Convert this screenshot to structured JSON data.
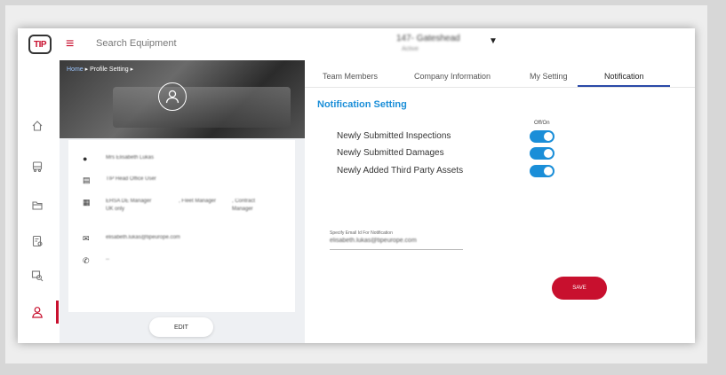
{
  "topbar": {
    "logo_text": "TIP",
    "search_placeholder": "Search Equipment",
    "site_name": "147- Gateshead",
    "site_sub": "Active"
  },
  "breadcrumb": {
    "home": "Home",
    "current": "Profile Setting"
  },
  "profile": {
    "name": "Mrs Elisabeth Lukas",
    "role": "TIP Head Office User",
    "position": {
      "col1": "EHSA DE Manager UK only",
      "col2": ", Fleet Manager",
      "col3": ", Contract Manager"
    },
    "email": "elisabeth.lukas@tipeurope.com",
    "phone": "--",
    "edit_label": "EDIT"
  },
  "tabs": [
    {
      "label": "Team Members"
    },
    {
      "label": "Company Information"
    },
    {
      "label": "My Setting"
    },
    {
      "label": "Notification"
    }
  ],
  "notification": {
    "section_title": "Notification Setting",
    "offon_label": "Off/On",
    "items": [
      {
        "label": "Newly Submitted Inspections",
        "enabled": true
      },
      {
        "label": "Newly Submitted Damages",
        "enabled": true
      },
      {
        "label": "Newly Added Third Party Assets",
        "enabled": true
      }
    ],
    "email_label": "Specify Email Id For Notification",
    "email_value": "elisabeth.lukas@tipeurope.com",
    "save_label": "SAVE"
  },
  "colors": {
    "brand_red": "#c8102e",
    "accent_blue": "#1a8ed8",
    "tab_underline": "#2b4aa8"
  },
  "icons": [
    "hamburger-icon",
    "home-icon",
    "truck-icon",
    "folder-icon",
    "report-icon",
    "search-truck-icon",
    "user-icon",
    "logout-icon",
    "person-icon",
    "id-card-icon",
    "badge-icon",
    "mail-icon",
    "phone-icon",
    "avatar-icon",
    "chevron-down-icon"
  ]
}
